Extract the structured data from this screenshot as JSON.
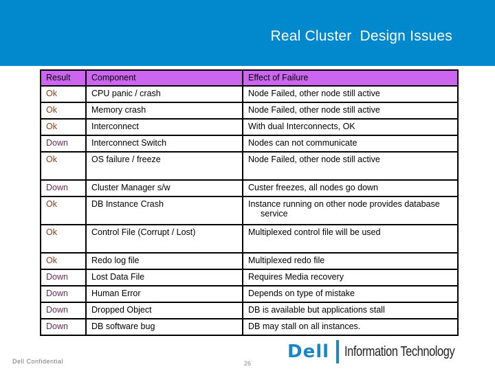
{
  "slide": {
    "title": "Real Cluster  Design Issues",
    "footer_left": "Dell Confidential",
    "page_number": "26",
    "logo": {
      "brand": "Dell",
      "tagline": "Information Technology"
    }
  },
  "colors": {
    "header_bg": "#0288cc",
    "table_header_bg": "#cc66f0",
    "ok_text": "#8b3a1a",
    "down_text": "#6a2a5a",
    "logo_blue": "#1a86c8"
  },
  "table": {
    "headers": [
      "Result",
      "Component",
      "Effect of Failure"
    ],
    "rows": [
      {
        "result": "Ok",
        "component": "CPU panic / crash",
        "effect": "Node Failed, other node still active"
      },
      {
        "result": "Ok",
        "component": "Memory crash",
        "effect": "Node Failed, other node still active"
      },
      {
        "result": "Ok",
        "component": "Interconnect",
        "effect": "With dual Interconnects, OK"
      },
      {
        "result": "Down",
        "component": "Interconnect Switch",
        "effect": "Nodes can not communicate"
      },
      {
        "result": "Ok",
        "component": "OS failure / freeze",
        "effect": "Node Failed, other node still active"
      },
      {
        "result": "Down",
        "component": "Cluster Manager s/w",
        "effect": "Custer freezes, all nodes go down"
      },
      {
        "result": "Ok",
        "component": "DB Instance Crash",
        "effect": "Instance running on other node provides database",
        "effect_cont": "service"
      },
      {
        "result": "Ok",
        "component": "Control File (Corrupt / Lost)",
        "effect": "Multiplexed control file will be used"
      },
      {
        "result": "Ok",
        "component": "Redo log file",
        "effect": "Multiplexed redo file"
      },
      {
        "result": "Down",
        "component": "Lost Data File",
        "effect": "Requires Media recovery"
      },
      {
        "result": "Down",
        "component": "Human Error",
        "effect": "Depends on type of mistake"
      },
      {
        "result": "Down",
        "component": "Dropped Object",
        "effect": "DB is available but applications stall"
      },
      {
        "result": "Down",
        "component": "DB software bug",
        "effect": "DB may stall on all instances."
      }
    ]
  }
}
